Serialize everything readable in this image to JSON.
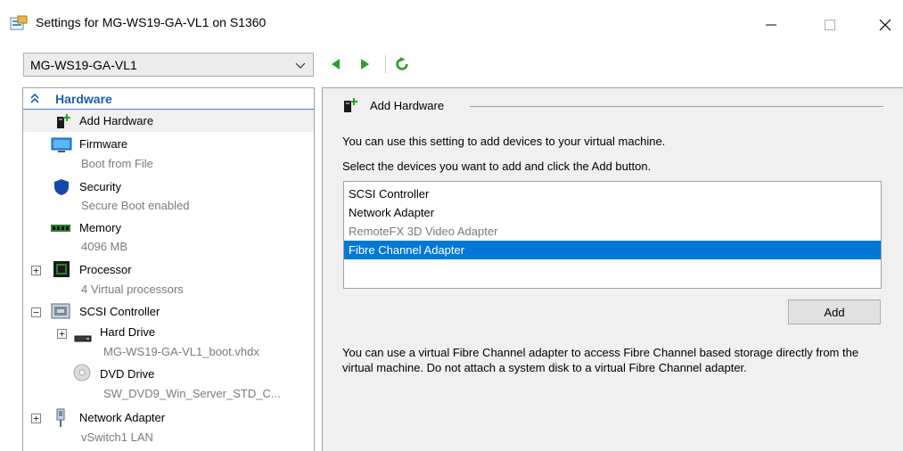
{
  "window": {
    "title": "Settings for MG-WS19-GA-VL1 on S1360",
    "icon": "settings-icon"
  },
  "vm_selector": {
    "selected": "MG-WS19-GA-VL1"
  },
  "tree": {
    "section_label": "Hardware",
    "items": [
      {
        "label": "Add Hardware",
        "icon": "add-hardware-icon"
      },
      {
        "label": "Firmware",
        "sub": "Boot from File",
        "icon": "firmware-icon"
      },
      {
        "label": "Security",
        "sub": "Secure Boot enabled",
        "icon": "shield-icon"
      },
      {
        "label": "Memory",
        "sub": "4096 MB",
        "icon": "memory-icon"
      },
      {
        "label": "Processor",
        "sub": "4 Virtual processors",
        "icon": "processor-icon"
      },
      {
        "label": "SCSI Controller",
        "icon": "scsi-controller-icon"
      },
      {
        "label": "Hard Drive",
        "sub": "MG-WS19-GA-VL1_boot.vhdx",
        "icon": "hard-drive-icon"
      },
      {
        "label": "DVD Drive",
        "sub": "SW_DVD9_Win_Server_STD_C...",
        "icon": "dvd-drive-icon"
      },
      {
        "label": "Network Adapter",
        "sub": "vSwitch1 LAN",
        "icon": "network-adapter-icon"
      }
    ]
  },
  "panel": {
    "group_title": "Add Hardware",
    "description1": "You can use this setting to add devices to your virtual machine.",
    "description2": "Select the devices you want to add and click the Add button.",
    "devices": [
      {
        "label": "SCSI Controller",
        "state": "normal"
      },
      {
        "label": "Network Adapter",
        "state": "normal"
      },
      {
        "label": "RemoteFX 3D Video Adapter",
        "state": "disabled"
      },
      {
        "label": "Fibre Channel Adapter",
        "state": "selected"
      }
    ],
    "add_button": "Add",
    "description3": "You can use a virtual Fibre Channel adapter to access Fibre Channel based storage directly from the virtual machine. Do not attach a system disk to a virtual Fibre Channel adapter."
  },
  "colors": {
    "selection": "#0078d7",
    "section_header": "#1c5cb8",
    "nav_green": "#2e9e2e"
  }
}
